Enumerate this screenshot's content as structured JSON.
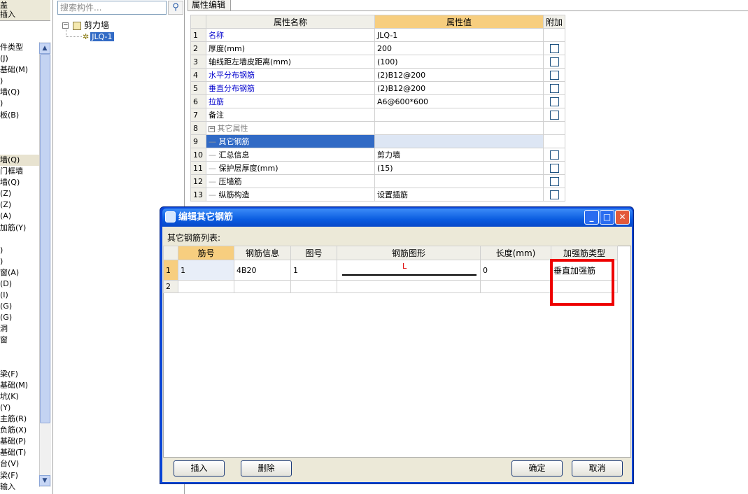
{
  "left_strip": {
    "top_label": "盖",
    "second_label": "插入",
    "items": [
      "件类型",
      "(J)",
      "基础(M)",
      ")",
      "墙(Q)",
      ")",
      "板(B)",
      "",
      "",
      "",
      "墙(Q)",
      "门框墙",
      "墙(Q)",
      "(Z)",
      "(Z)",
      "(A)",
      "加筋(Y)",
      "",
      ")",
      ")",
      "窗(A)",
      "(D)",
      "(I)",
      "(G)",
      "(G)",
      "洞",
      "窗",
      "",
      "",
      "梁(F)",
      "基础(M)",
      "坑(K)",
      "(Y)",
      "主筋(R)",
      "负筋(X)",
      "基础(P)",
      "基础(T)",
      "台(V)",
      "梁(F)",
      "输入"
    ],
    "selected_index": 10
  },
  "search": {
    "placeholder": "搜索构件..."
  },
  "tree": {
    "root_label": "剪力墙",
    "child_label": "JLQ-1"
  },
  "property_panel": {
    "tab_label": "属性编辑",
    "headers": {
      "name": "属性名称",
      "value": "属性值",
      "extra": "附加"
    },
    "rows": [
      {
        "num": "1",
        "name": "名称",
        "value": "JLQ-1",
        "style": "blue",
        "check": false
      },
      {
        "num": "2",
        "name": "厚度(mm)",
        "value": "200",
        "style": "",
        "check": true
      },
      {
        "num": "3",
        "name": "轴线距左墙皮距离(mm)",
        "value": "(100)",
        "style": "",
        "check": true
      },
      {
        "num": "4",
        "name": "水平分布钢筋",
        "value": "(2)B12@200",
        "style": "blue",
        "check": true
      },
      {
        "num": "5",
        "name": "垂直分布钢筋",
        "value": "(2)B12@200",
        "style": "blue",
        "check": true
      },
      {
        "num": "6",
        "name": "拉筋",
        "value": "A6@600*600",
        "style": "blue",
        "check": true
      },
      {
        "num": "7",
        "name": "备注",
        "value": "",
        "style": "",
        "check": true
      },
      {
        "num": "8",
        "name": "其它属性",
        "value": "",
        "style": "gray",
        "check": false
      },
      {
        "num": "9",
        "name": "其它钢筋",
        "value": "",
        "style": "sel",
        "check": false
      },
      {
        "num": "10",
        "name": "汇总信息",
        "value": "剪力墙",
        "style": "",
        "check": true
      },
      {
        "num": "11",
        "name": "保护层厚度(mm)",
        "value": "(15)",
        "style": "",
        "check": true
      },
      {
        "num": "12",
        "name": "压墙筋",
        "value": "",
        "style": "",
        "check": true
      },
      {
        "num": "13",
        "name": "纵筋构造",
        "value": "设置插筋",
        "style": "",
        "check": true
      }
    ],
    "expander_symbol": "−"
  },
  "dialog": {
    "title": "编辑其它钢筋",
    "list_label": "其它钢筋列表:",
    "headers": [
      "筋号",
      "钢筋信息",
      "图号",
      "钢筋图形",
      "长度(mm)",
      "加强筋类型"
    ],
    "rows": [
      {
        "num": "1",
        "bar_no": "1",
        "info": "4B20",
        "fig_no": "1",
        "shape_label": "L",
        "length": "0",
        "type": "垂直加强筋"
      },
      {
        "num": "2",
        "bar_no": "",
        "info": "",
        "fig_no": "",
        "shape_label": "",
        "length": "",
        "type": ""
      }
    ],
    "buttons": {
      "insert": "插入",
      "delete": "删除",
      "ok": "确定",
      "cancel": "取消"
    },
    "title_buttons": {
      "min": "_",
      "max": "□",
      "close": "✕"
    }
  }
}
